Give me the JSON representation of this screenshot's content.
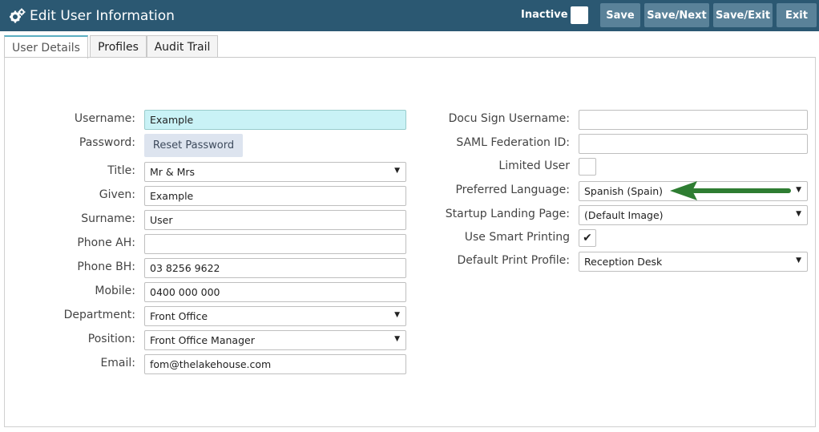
{
  "header": {
    "title": "Edit User Information",
    "title_icon": "gears-icon",
    "inactive_label": "Inactive",
    "inactive_checked": false,
    "buttons": {
      "save": "Save",
      "save_next": "Save/Next",
      "save_exit": "Save/Exit",
      "exit": "Exit"
    }
  },
  "tabs": [
    {
      "label": "User Details",
      "active": true
    },
    {
      "label": "Profiles",
      "active": false
    },
    {
      "label": "Audit Trail",
      "active": false
    }
  ],
  "left_form": {
    "username": {
      "label": "Username:",
      "value": "Example"
    },
    "password": {
      "label": "Password:",
      "button": "Reset Password"
    },
    "title": {
      "label": "Title:",
      "value": "Mr & Mrs"
    },
    "given": {
      "label": "Given:",
      "value": "Example"
    },
    "surname": {
      "label": "Surname:",
      "value": "User"
    },
    "phone_ah": {
      "label": "Phone AH:",
      "value": ""
    },
    "phone_bh": {
      "label": "Phone BH:",
      "value": "03 8256 9622"
    },
    "mobile": {
      "label": "Mobile:",
      "value": "0400 000 000"
    },
    "department": {
      "label": "Department:",
      "value": "Front Office"
    },
    "position": {
      "label": "Position:",
      "value": "Front Office Manager"
    },
    "email": {
      "label": "Email:",
      "value": "fom@thelakehouse.com"
    }
  },
  "right_form": {
    "docusign": {
      "label": "Docu Sign Username:",
      "value": ""
    },
    "saml": {
      "label": "SAML Federation ID:",
      "value": ""
    },
    "limited_user": {
      "label": "Limited User",
      "checked": false
    },
    "language": {
      "label": "Preferred Language:",
      "value": "Spanish (Spain)"
    },
    "landing": {
      "label": "Startup Landing Page:",
      "value": "(Default Image)"
    },
    "smart_printing": {
      "label": "Use Smart Printing",
      "checked": true,
      "mark": "✔"
    },
    "print_profile": {
      "label": "Default Print Profile:",
      "value": "Reception Desk"
    }
  },
  "colors": {
    "header_bg": "#2b5872",
    "button_bg": "#5a8299",
    "highlight": "#c9f2f6",
    "arrow": "#2e7d32"
  }
}
